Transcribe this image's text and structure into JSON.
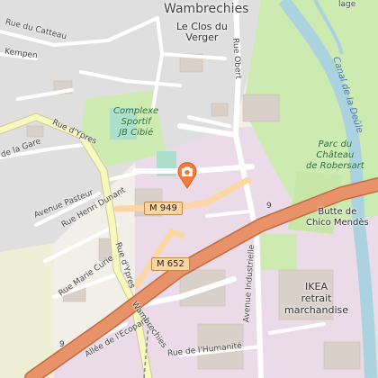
{
  "map": {
    "town": "Wambrechies",
    "places": {
      "clos_du_verger": "Le Clos du\nVerger",
      "complexe_sportif": "Complexe\nSportif\nJB Cibié",
      "parc_robersart": "Parc du\nChâteau\nde Robersart",
      "butte_chico": "Butte de\nChico Mendès",
      "ikea": "IKEA\nretrait\nmarchandise"
    },
    "streets": {
      "rue_du_catteau": "Rue du Catteau",
      "kempen": "Kempen",
      "rue_dypres_top": "Rue d'Ypres",
      "rue_de_la_gare": "de la Gare",
      "avenue_pasteur": "Avenue Pasteur",
      "rue_henri_dunant": "Rue Henri Dunant",
      "rue_marie_curie": "Rue Marie Curie",
      "rue_dypres_bottom": "Rue d'Ypres",
      "rue_obert": "Rue Obert",
      "avenue_industrielle": "Avenue Industrielle",
      "allee_ecopark": "Allée de l'Ecopark",
      "rue_humanite": "Rue de l'Humanité",
      "wambrechies_road": "Wambrechies",
      "lage": "lage"
    },
    "waterway": "Canal de la Deûle",
    "route_shields": [
      "M 949",
      "M 652"
    ],
    "route_numbers": [
      "9",
      "9"
    ],
    "marker_icon": "camera-icon"
  }
}
